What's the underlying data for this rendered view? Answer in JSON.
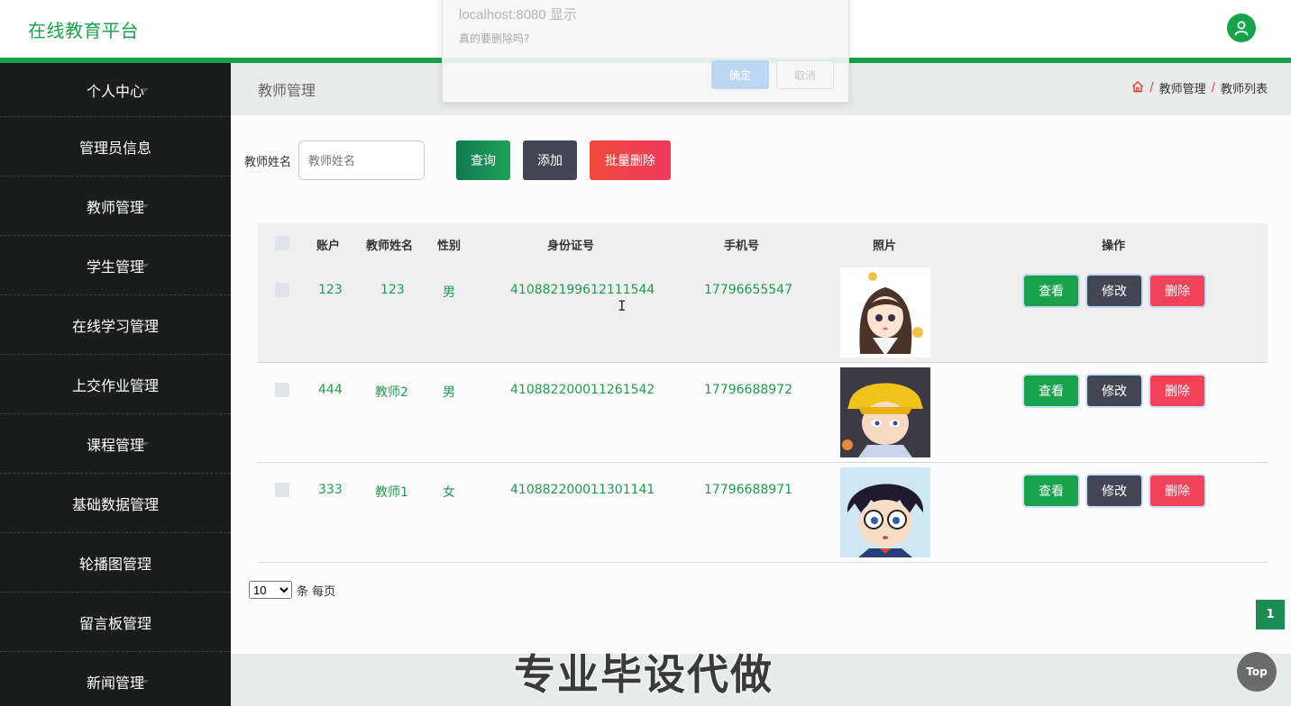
{
  "header": {
    "brand": "在线教育平台",
    "user_icon": "user-icon",
    "accent": "#16a34a"
  },
  "sidebar": {
    "items": [
      {
        "label": "个人中心"
      },
      {
        "label": "管理员信息"
      },
      {
        "label": "教师管理"
      },
      {
        "label": "学生管理"
      },
      {
        "label": "在线学习管理"
      },
      {
        "label": "上交作业管理"
      },
      {
        "label": "课程管理"
      },
      {
        "label": "基础数据管理"
      },
      {
        "label": "轮播图管理"
      },
      {
        "label": "留言板管理"
      },
      {
        "label": "新闻管理"
      }
    ]
  },
  "crumbbar": {
    "title": "教师管理",
    "home_icon": "home-icon",
    "separator": "/",
    "crumbs": [
      "教师管理",
      "教师列表"
    ]
  },
  "search": {
    "label": "教师姓名",
    "placeholder": "教师姓名",
    "query_label": "查询",
    "add_label": "添加",
    "batch_delete_label": "批量删除"
  },
  "table": {
    "headers": {
      "account": "账户",
      "name": "教师姓名",
      "gender": "性别",
      "id_card": "身份证号",
      "phone": "手机号",
      "photo": "照片",
      "ops": "操作"
    },
    "op_labels": {
      "view": "查看",
      "edit": "修改",
      "delete": "删除"
    },
    "rows": [
      {
        "account": "123",
        "name": "123",
        "gender": "男",
        "id_card": "410882199612111544",
        "phone": "17796655547"
      },
      {
        "account": "444",
        "name": "教师2",
        "gender": "男",
        "id_card": "410882200011261542",
        "phone": "17796688972"
      },
      {
        "account": "333",
        "name": "教师1",
        "gender": "女",
        "id_card": "410882200011301141",
        "phone": "17796688971"
      }
    ]
  },
  "pagination": {
    "page_size": "10",
    "per_page_label": "条 每页",
    "current_page": "1"
  },
  "dialog": {
    "title": "localhost:8080 显示",
    "message": "真的要删除吗?",
    "ok_label": "确定",
    "cancel_label": "取消"
  },
  "footer": {
    "watermark": "专业毕设代做",
    "top_label": "Top"
  }
}
